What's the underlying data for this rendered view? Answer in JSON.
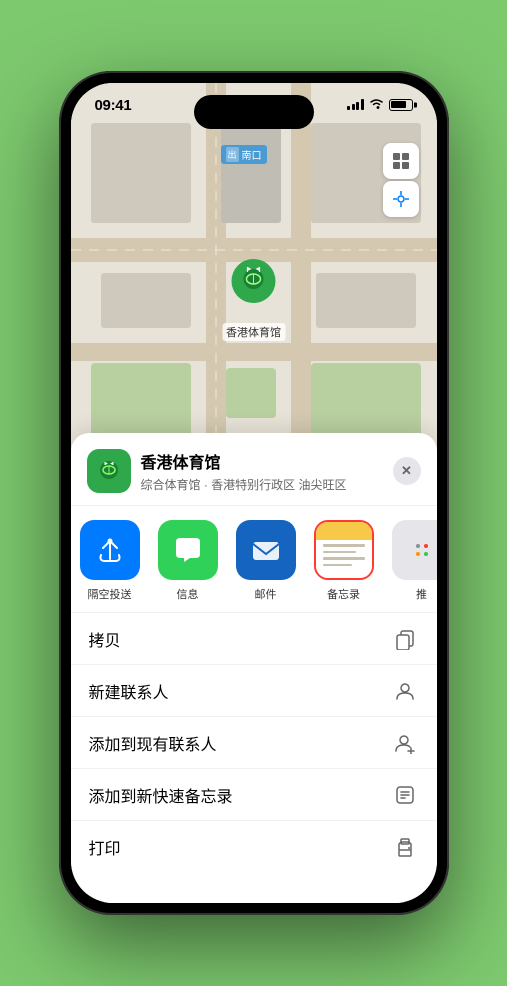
{
  "status": {
    "time": "09:41",
    "location_arrow": "▶"
  },
  "map": {
    "label_text": "南口",
    "label_prefix": "出",
    "pin_label": "香港体育馆",
    "map_icon": "🗺",
    "location_icon": "⊕"
  },
  "place": {
    "name": "香港体育馆",
    "description": "综合体育馆 · 香港特别行政区 油尖旺区",
    "close_label": "✕"
  },
  "share_apps": [
    {
      "id": "airdrop",
      "label": "隔空投送",
      "icon_type": "airdrop"
    },
    {
      "id": "messages",
      "label": "信息",
      "icon_type": "messages"
    },
    {
      "id": "mail",
      "label": "邮件",
      "icon_type": "mail"
    },
    {
      "id": "notes",
      "label": "备忘录",
      "icon_type": "notes",
      "selected": true
    },
    {
      "id": "more",
      "label": "推",
      "icon_type": "more"
    }
  ],
  "actions": [
    {
      "id": "copy",
      "label": "拷贝",
      "icon": "copy"
    },
    {
      "id": "new-contact",
      "label": "新建联系人",
      "icon": "person"
    },
    {
      "id": "add-contact",
      "label": "添加到现有联系人",
      "icon": "person-add"
    },
    {
      "id": "quick-note",
      "label": "添加到新快速备忘录",
      "icon": "note"
    },
    {
      "id": "print",
      "label": "打印",
      "icon": "print"
    }
  ],
  "colors": {
    "green_accent": "#2ea84b",
    "blue_accent": "#007aff",
    "red_border": "#ff3b30",
    "notes_yellow": "#f7c948"
  }
}
